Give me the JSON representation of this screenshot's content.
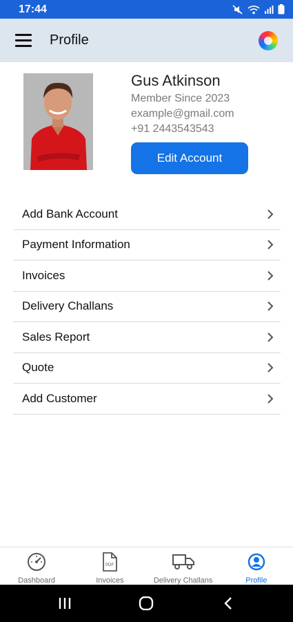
{
  "status": {
    "time": "17:44"
  },
  "app_bar": {
    "title": "Profile"
  },
  "profile": {
    "name": "Gus Atkinson",
    "member_since": "Member Since 2023",
    "email": "example@gmail.com",
    "phone": "+91 2443543543",
    "edit_label": "Edit Account"
  },
  "menu": [
    {
      "label": "Add Bank Account"
    },
    {
      "label": "Payment Information"
    },
    {
      "label": "Invoices"
    },
    {
      "label": "Delivery Challans"
    },
    {
      "label": "Sales Report"
    },
    {
      "label": "Quote"
    },
    {
      "label": "Add Customer"
    }
  ],
  "bottom_nav": [
    {
      "label": "Dashboard",
      "icon": "speedometer-icon",
      "active": false
    },
    {
      "label": "Invoices",
      "icon": "pdf-file-icon",
      "active": false
    },
    {
      "label": "Delivery Challans",
      "icon": "truck-icon",
      "active": false
    },
    {
      "label": "Profile",
      "icon": "user-circle-icon",
      "active": true
    }
  ],
  "colors": {
    "status_bar": "#1b63d8",
    "app_bar": "#dde5ee",
    "accent": "#1473e6"
  }
}
